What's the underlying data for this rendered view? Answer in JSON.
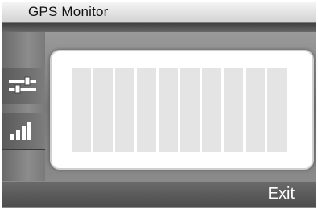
{
  "window": {
    "title": "GPS Monitor"
  },
  "sidebar": {
    "items": [
      {
        "icon": "sliders-icon"
      },
      {
        "icon": "signal-strength-icon"
      }
    ]
  },
  "signal_panel": {
    "bar_count": 10
  },
  "footer": {
    "exit_label": "Exit"
  }
}
